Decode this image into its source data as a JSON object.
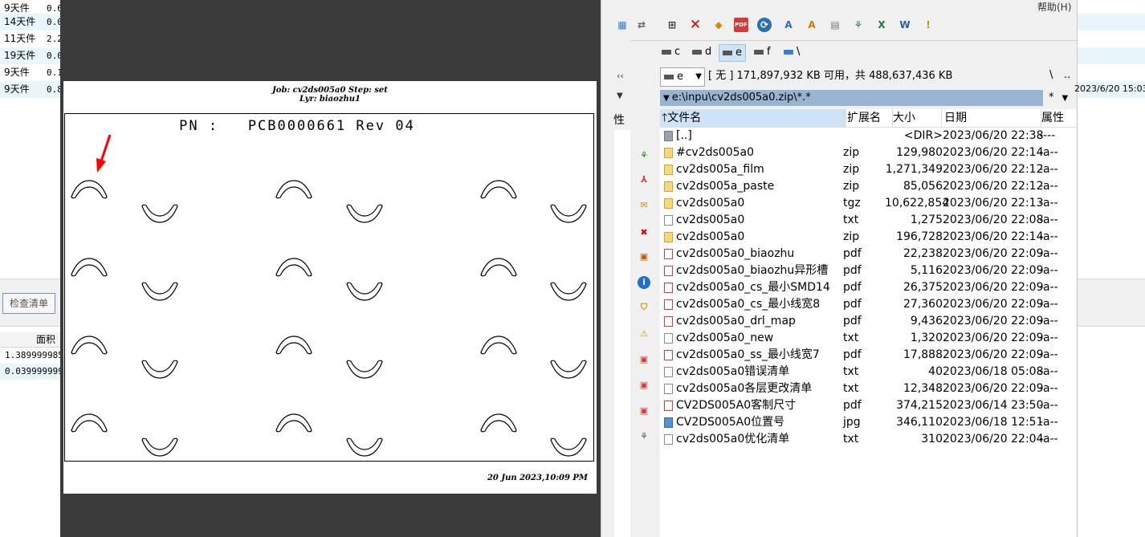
{
  "background_left": {
    "rows": [
      {
        "label": "9天件",
        "value": "0.6"
      },
      {
        "label": "14天件",
        "value": "0.0"
      },
      {
        "label": "11天件",
        "value": "2.2"
      },
      {
        "label": "19天件",
        "value": "0.0"
      },
      {
        "label": "9天件",
        "value": "0.1"
      },
      {
        "label": "9天件",
        "value": "0.8"
      }
    ],
    "check_button": "检查清单",
    "area_header": "面积",
    "area_values": [
      "1.389999985",
      "0.039999999"
    ]
  },
  "viewer": {
    "job_line": "Job: cv2ds005a0  Step: set",
    "layer_line": "Lyr: biaozhu1",
    "pn_text": "PN :   PCB0000661 Rev 04",
    "footer_date": "20 Jun 2023,10:09 PM",
    "annotation_color": "#ff0000"
  },
  "file_manager": {
    "menu_help": "帮助(H)",
    "drives": [
      {
        "letter": "c"
      },
      {
        "letter": "d"
      },
      {
        "letter": "e"
      },
      {
        "letter": "f"
      },
      {
        "letter": "\\"
      }
    ],
    "selected_drive": "e",
    "drive_info": "[ 无 ]  171,897,932 KB 可用，共 488,637,436 KB",
    "nav_root": "\\",
    "nav_up": "..",
    "path": "e:\\inpu\\cv2ds005a0.zip\\*.*",
    "filter": "*",
    "columns": {
      "name": "文件名",
      "ext": "扩展名",
      "size": "大小",
      "date": "日期",
      "attr": "属性"
    },
    "files": [
      {
        "icon": "up",
        "name": "[..]",
        "ext": "",
        "size": "<DIR>",
        "date": "2023/06/20 22:38",
        "attr": "----"
      },
      {
        "icon": "zip",
        "name": "#cv2ds005a0",
        "ext": "zip",
        "size": "129,980",
        "date": "2023/06/20 22:14",
        "attr": "-a--"
      },
      {
        "icon": "zip",
        "name": "cv2ds005a_film",
        "ext": "zip",
        "size": "1,271,349",
        "date": "2023/06/20 22:12",
        "attr": "-a--"
      },
      {
        "icon": "zip",
        "name": "cv2ds005a_paste",
        "ext": "zip",
        "size": "85,056",
        "date": "2023/06/20 22:12",
        "attr": "-a--"
      },
      {
        "icon": "zip",
        "name": "cv2ds005a0",
        "ext": "tgz",
        "size": "10,622,854",
        "date": "2023/06/20 22:13",
        "attr": "-a--"
      },
      {
        "icon": "txt",
        "name": "cv2ds005a0",
        "ext": "txt",
        "size": "1,275",
        "date": "2023/06/20 22:08",
        "attr": "-a--"
      },
      {
        "icon": "zip",
        "name": "cv2ds005a0",
        "ext": "zip",
        "size": "196,728",
        "date": "2023/06/20 22:14",
        "attr": "-a--"
      },
      {
        "icon": "pdf",
        "name": "cv2ds005a0_biaozhu",
        "ext": "pdf",
        "size": "22,238",
        "date": "2023/06/20 22:09",
        "attr": "-a--"
      },
      {
        "icon": "pdf",
        "name": "cv2ds005a0_biaozhu异形槽",
        "ext": "pdf",
        "size": "5,116",
        "date": "2023/06/20 22:09",
        "attr": "-a--"
      },
      {
        "icon": "pdf",
        "name": "cv2ds005a0_cs_最小SMD14",
        "ext": "pdf",
        "size": "26,375",
        "date": "2023/06/20 22:09",
        "attr": "-a--"
      },
      {
        "icon": "pdf",
        "name": "cv2ds005a0_cs_最小线宽8",
        "ext": "pdf",
        "size": "27,360",
        "date": "2023/06/20 22:09",
        "attr": "-a--"
      },
      {
        "icon": "pdf",
        "name": "cv2ds005a0_drl_map",
        "ext": "pdf",
        "size": "9,436",
        "date": "2023/06/20 22:09",
        "attr": "-a--"
      },
      {
        "icon": "txt",
        "name": "cv2ds005a0_new",
        "ext": "txt",
        "size": "1,320",
        "date": "2023/06/20 22:09",
        "attr": "-a--"
      },
      {
        "icon": "pdf",
        "name": "cv2ds005a0_ss_最小线宽7",
        "ext": "pdf",
        "size": "17,888",
        "date": "2023/06/20 22:09",
        "attr": "-a--"
      },
      {
        "icon": "txt",
        "name": "cv2ds005a0错误清单",
        "ext": "txt",
        "size": "40",
        "date": "2023/06/18 05:08",
        "attr": "-a--"
      },
      {
        "icon": "txt",
        "name": "cv2ds005a0各层更改清单",
        "ext": "txt",
        "size": "12,348",
        "date": "2023/06/20 22:09",
        "attr": "-a--"
      },
      {
        "icon": "pdf",
        "name": "CV2DS005A0客制尺寸",
        "ext": "pdf",
        "size": "374,215",
        "date": "2023/06/14 23:50",
        "attr": "-a--"
      },
      {
        "icon": "jpg",
        "name": "CV2DS005A0位置号",
        "ext": "jpg",
        "size": "346,110",
        "date": "2023/06/18 12:51",
        "attr": "-a--"
      },
      {
        "icon": "txt",
        "name": "cv2ds005a0优化清单",
        "ext": "txt",
        "size": "310",
        "date": "2023/06/20 22:04",
        "attr": "-a--"
      }
    ]
  },
  "background_right": {
    "date_text": "2023/6/20 15:03"
  }
}
